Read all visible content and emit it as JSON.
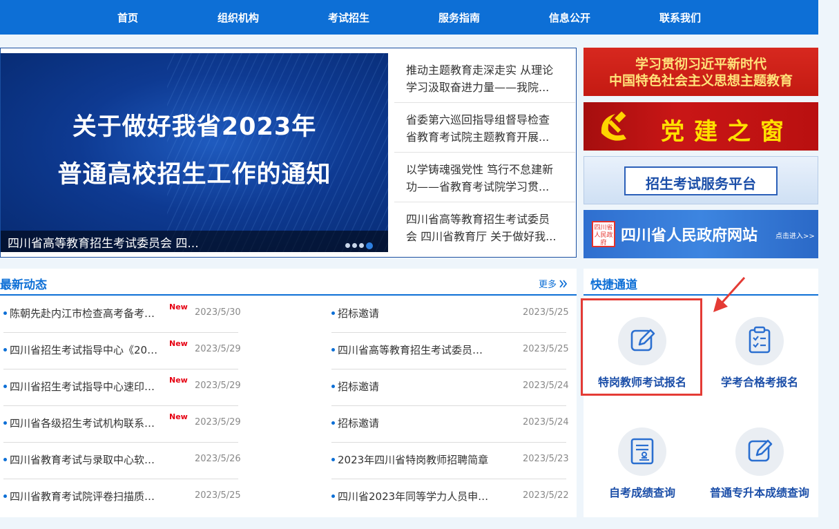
{
  "nav": {
    "items": [
      "首页",
      "组织机构",
      "考试招生",
      "服务指南",
      "信息公开",
      "联系我们"
    ]
  },
  "slider": {
    "headline_line1": "关于做好我省2023年",
    "headline_line2": "普通高校招生工作的通知",
    "caption": "四川省高等教育招生考试委员会 四...",
    "dots": 4,
    "active_dot": 4
  },
  "side_news": [
    {
      "line1": "推动主题教育走深走实 从理论",
      "line2": "学习汲取奋进力量——我院..."
    },
    {
      "line1": "省委第六巡回指导组督导检查",
      "line2": "省教育考试院主题教育开展..."
    },
    {
      "line1": "以学铸魂强党性 笃行不怠建新",
      "line2": "功——省教育考试院学习贯..."
    },
    {
      "line1": "四川省高等教育招生考试委员",
      "line2": "会 四川省教育厅 关于做好我..."
    }
  ],
  "banners": {
    "b1_line1": "学习贯彻习近平新时代",
    "b1_line2": "中国特色社会主义思想主题教育",
    "b2_text": "党建之窗",
    "b3_text": "招生考试服务平台",
    "b4_seal": "四川省人民政府",
    "b4_text": "四川省人民政府网站",
    "b4_small": "点击进入>>"
  },
  "news": {
    "title": "最新动态",
    "more": "更多",
    "new_label": "New",
    "left": [
      {
        "text": "陈朝先赴内江市检查高考备考…",
        "date": "2023/5/30",
        "is_new": true
      },
      {
        "text": "四川省招生考试指导中心《20…",
        "date": "2023/5/29",
        "is_new": true
      },
      {
        "text": "四川省招生考试指导中心速印…",
        "date": "2023/5/29",
        "is_new": true
      },
      {
        "text": "四川省各级招生考试机构联系…",
        "date": "2023/5/29",
        "is_new": true
      },
      {
        "text": "四川省教育考试与录取中心软…",
        "date": "2023/5/26",
        "is_new": false
      },
      {
        "text": "四川省教育考试院评卷扫描质…",
        "date": "2023/5/25",
        "is_new": false
      }
    ],
    "right": [
      {
        "text": "招标邀请",
        "date": "2023/5/25"
      },
      {
        "text": "四川省高等教育招生考试委员…",
        "date": "2023/5/25"
      },
      {
        "text": "招标邀请",
        "date": "2023/5/24"
      },
      {
        "text": "招标邀请",
        "date": "2023/5/24"
      },
      {
        "text": "2023年四川省特岗教师招聘简章",
        "date": "2023/5/23"
      },
      {
        "text": "四川省2023年同等学力人员申…",
        "date": "2023/5/22"
      }
    ]
  },
  "quick": {
    "title": "快捷通道",
    "items": [
      {
        "label": "特岗教师考试报名",
        "icon": "edit-icon"
      },
      {
        "label": "学考合格考报名",
        "icon": "clipboard-check-icon"
      },
      {
        "label": "自考成绩查询",
        "icon": "document-stamp-icon"
      },
      {
        "label": "普通专升本成绩查询",
        "icon": "edit-icon"
      }
    ]
  },
  "colors": {
    "primary": "#0d6fd6",
    "highlight": "#e43b35",
    "new_red": "#e60012"
  }
}
